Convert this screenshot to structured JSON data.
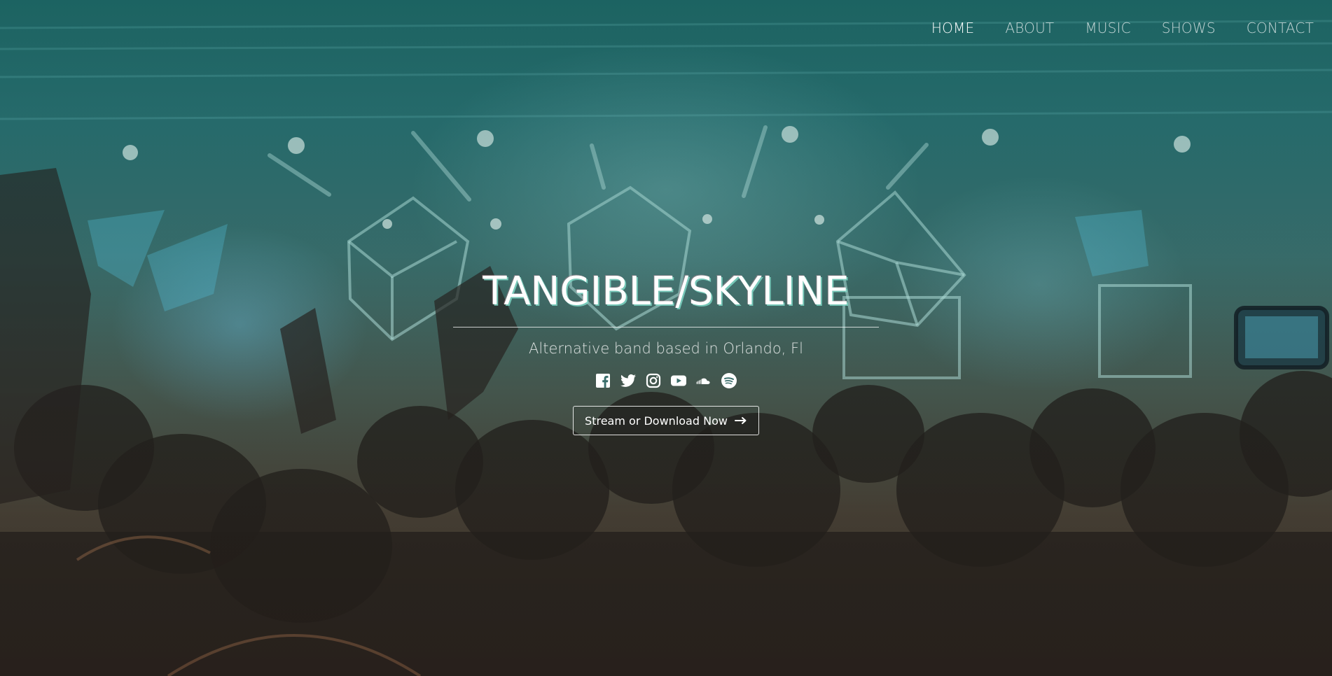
{
  "nav": {
    "items": [
      {
        "label": "HOME",
        "active": true
      },
      {
        "label": "ABOUT",
        "active": false
      },
      {
        "label": "MUSIC",
        "active": false
      },
      {
        "label": "SHOWS",
        "active": false
      },
      {
        "label": "CONTACT",
        "active": false
      }
    ]
  },
  "hero": {
    "title": "TANGIBLE/SKYLINE",
    "subtitle": "Alternative band based in Orlando, Fl",
    "cta_label": "Stream or Download Now",
    "cta_icon": "arrow-right-icon"
  },
  "social": {
    "icons": [
      "facebook-icon",
      "twitter-icon",
      "instagram-icon",
      "youtube-icon",
      "soundcloud-icon",
      "spotify-icon"
    ]
  },
  "colors": {
    "title_shadow": "#7ed6c4",
    "text": "#ffffff",
    "background_top": "#1f6664",
    "background_bottom": "#3a2f28"
  }
}
